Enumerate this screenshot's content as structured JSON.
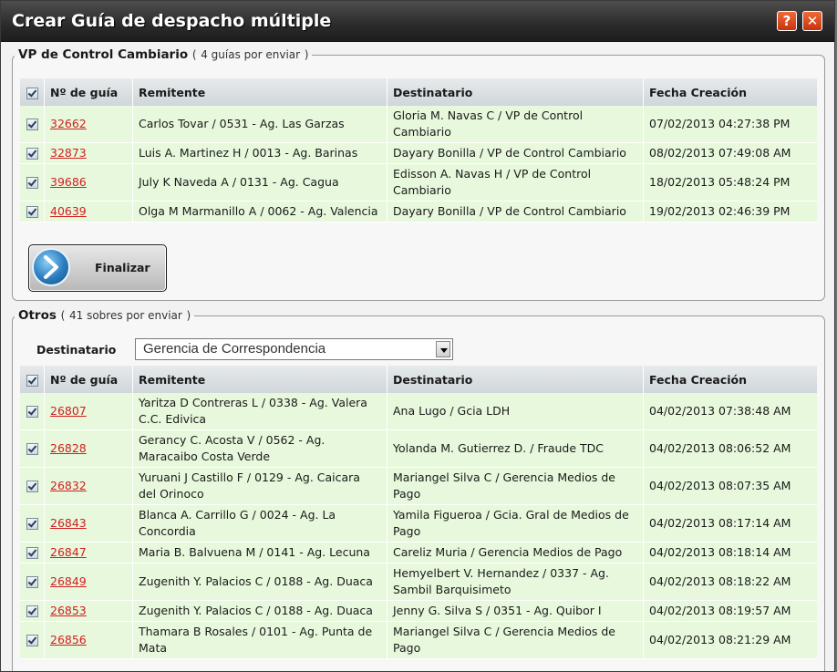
{
  "window": {
    "title": "Crear Guía de despacho múltiple",
    "help_label": "?",
    "close_label": "✕"
  },
  "section1": {
    "legend": "VP de Control Cambiario",
    "count_open": "(",
    "count": "4 guías por enviar",
    "count_close": ")",
    "headers": [
      "Nº de guía",
      "Remitente",
      "Destinatario",
      "Fecha Creación"
    ],
    "rows": [
      {
        "guia": "32662",
        "remitente": "Carlos Tovar / 0531 - Ag. Las Garzas",
        "destinatario": "Gloria M. Navas C / VP de Control Cambiario",
        "fecha": "07/02/2013 04:27:38 PM"
      },
      {
        "guia": "32873",
        "remitente": "Luis A. Martinez H / 0013 - Ag. Barinas",
        "destinatario": "Dayary Bonilla / VP de Control Cambiario",
        "fecha": "08/02/2013 07:49:08 AM"
      },
      {
        "guia": "39686",
        "remitente": "July K Naveda A / 0131 - Ag. Cagua",
        "destinatario": "Edisson A. Navas H / VP de Control Cambiario",
        "fecha": "18/02/2013 05:48:24 PM"
      },
      {
        "guia": "40639",
        "remitente": "Olga M Marmanillo A / 0062 - Ag. Valencia",
        "destinatario": "Dayary Bonilla / VP de Control Cambiario",
        "fecha": "19/02/2013 02:46:39 PM"
      }
    ],
    "finalizar_label": "Finalizar"
  },
  "section2": {
    "legend": "Otros",
    "count_open": "(",
    "count": "41 sobres por enviar",
    "count_close": ")",
    "destinatario_label": "Destinatario",
    "destinatario_value": "Gerencia de Correspondencia",
    "headers": [
      "Nº de guía",
      "Remitente",
      "Destinatario",
      "Fecha Creación"
    ],
    "rows": [
      {
        "guia": "26807",
        "remitente": "Yaritza D Contreras L / 0338 - Ag. Valera C.C. Edivica",
        "destinatario": "Ana Lugo / Gcia LDH",
        "fecha": "04/02/2013 07:38:48 AM"
      },
      {
        "guia": "26828",
        "remitente": "Gerancy C. Acosta V / 0562 - Ag. Maracaibo Costa Verde",
        "destinatario": "Yolanda M. Gutierrez D. / Fraude TDC",
        "fecha": "04/02/2013 08:06:52 AM"
      },
      {
        "guia": "26832",
        "remitente": "Yuruani J Castillo F / 0129 - Ag. Caicara del Orinoco",
        "destinatario": "Mariangel Silva C / Gerencia Medios de Pago",
        "fecha": "04/02/2013 08:07:35 AM"
      },
      {
        "guia": "26843",
        "remitente": "Blanca A. Carrillo G / 0024 - Ag. La Concordia",
        "destinatario": "Yamila Figueroa / Gcia. Gral de Medios de Pago",
        "fecha": "04/02/2013 08:17:14 AM"
      },
      {
        "guia": "26847",
        "remitente": "Maria B. Balvuena M / 0141 - Ag. Lecuna",
        "destinatario": "Careliz Muria / Gerencia Medios de Pago",
        "fecha": "04/02/2013 08:18:14 AM"
      },
      {
        "guia": "26849",
        "remitente": "Zugenith Y. Palacios C / 0188 - Ag. Duaca",
        "destinatario": "Hemyelbert V. Hernandez / 0337 - Ag. Sambil Barquisimeto",
        "fecha": "04/02/2013 08:18:22 AM"
      },
      {
        "guia": "26853",
        "remitente": "Zugenith Y. Palacios C / 0188 - Ag. Duaca",
        "destinatario": "Jenny G. Silva S / 0351 - Ag. Quibor I",
        "fecha": "04/02/2013 08:19:57 AM"
      },
      {
        "guia": "26856",
        "remitente": "Thamara B Rosales / 0101 - Ag. Punta de Mata",
        "destinatario": "Mariangel Silva C / Gerencia Medios de Pago",
        "fecha": "04/02/2013 08:21:29 AM"
      }
    ]
  },
  "colors": {
    "row_bg": "#e8f8dc",
    "link": "#d02020",
    "title_bg": "#2b2b2b"
  }
}
